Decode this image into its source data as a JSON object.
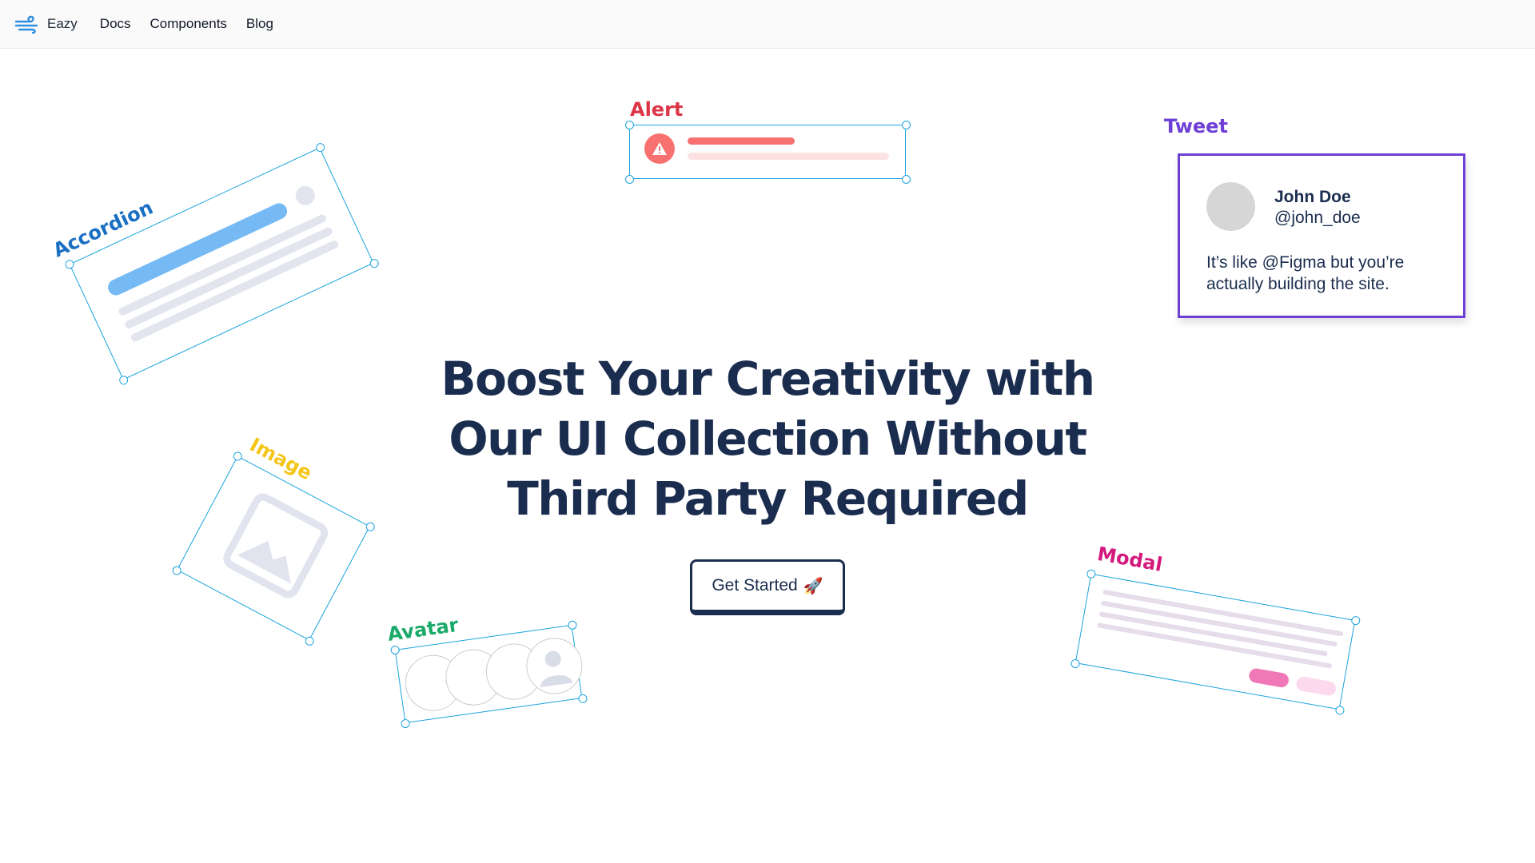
{
  "nav": {
    "brand": "Eazy",
    "links": [
      "Docs",
      "Components",
      "Blog"
    ]
  },
  "hero": {
    "title_lines": [
      "Boost Your Creativity with",
      "Our UI Collection Without",
      "Third Party Required"
    ],
    "cta_label": "Get Started",
    "cta_icon": "🚀"
  },
  "illustrations": {
    "alert_label": "Alert",
    "accordion_label": "Accordion",
    "image_label": "Image",
    "avatar_label": "Avatar",
    "modal_label": "Modal",
    "tweet_label": "Tweet"
  },
  "tweet": {
    "name": "John Doe",
    "handle": "@john_doe",
    "text": "It’s like @Figma but you’re actually building the site."
  },
  "colors": {
    "heading": "#1b2d4f",
    "frame": "#1aa3dd",
    "alert": "#dc3545",
    "tweet": "#6d3fd6",
    "accordion": "#1a6fc2",
    "image": "#f5c518",
    "avatar": "#1aaa6a",
    "modal": "#d3197e"
  }
}
